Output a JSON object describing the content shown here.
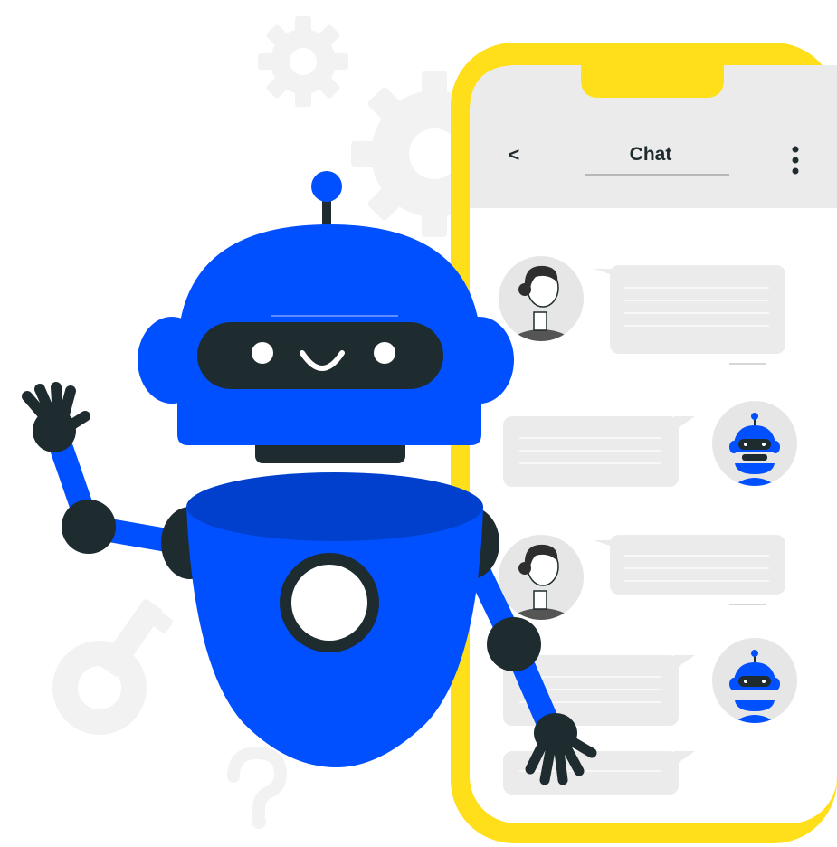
{
  "app": {
    "title": "Chat",
    "back_glyph": "<",
    "menu_icon": "kebab-menu-icon"
  },
  "colors": {
    "phone_frame": "#FFDE1A",
    "robot_blue": "#0050FF",
    "robot_blue_dark": "#0040CC",
    "dark": "#1E2B2F",
    "screen_bg": "#FFFFFF",
    "header_bg": "#EBEBEB",
    "bubble": "#EBEBEB",
    "background_shapes": "#F2F2F2"
  },
  "messages": [
    {
      "sender": "user",
      "avatar": "woman-avatar"
    },
    {
      "sender": "bot",
      "avatar": "bot-avatar"
    },
    {
      "sender": "user",
      "avatar": "woman-avatar"
    },
    {
      "sender": "bot",
      "avatar": "bot-avatar"
    },
    {
      "sender": "bot",
      "avatar": ""
    }
  ],
  "decorations": [
    "gear-icon",
    "gear-icon",
    "key-icon",
    "question-mark-icon"
  ]
}
